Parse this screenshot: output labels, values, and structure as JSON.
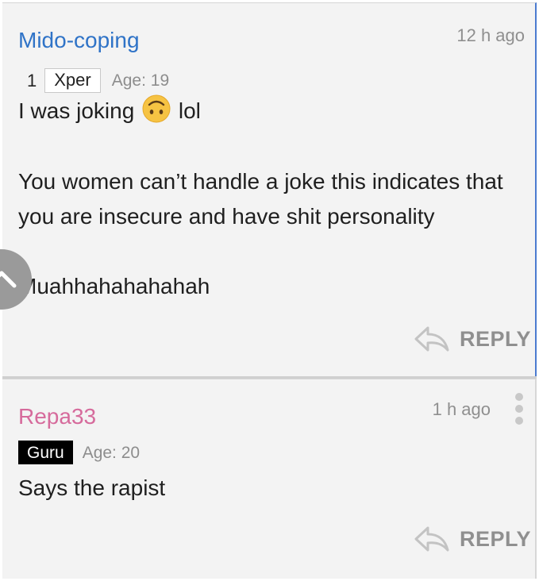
{
  "comments": [
    {
      "username": "Mido-coping",
      "timestamp": "12 h ago",
      "rank_number": "1",
      "badge": "Xper",
      "age": "Age: 19",
      "line1_before": "I was joking ",
      "line1_emoji": "upside-down-face-emoji",
      "line1_after": " lol",
      "paragraph2": "You women can’t handle a joke this indicates that you are insecure and have shit personality",
      "paragraph3": "Muahhahahahahah",
      "reply_label": "REPLY"
    },
    {
      "username": "Repa33",
      "timestamp": "1 h ago",
      "badge": "Guru",
      "age": "Age: 20",
      "text": "Says the rapist",
      "reply_label": "REPLY"
    }
  ],
  "icons": {
    "reply": "reply-arrow-icon",
    "more": "kebab-menu-icon",
    "scroll": "chevron-up-icon"
  },
  "colors": {
    "username_1": "#2f73c7",
    "username_2": "#d66b9c",
    "accent_border": "#4a7bd0",
    "badge_solid": "#000000",
    "muted_text": "#8f8f8f"
  }
}
